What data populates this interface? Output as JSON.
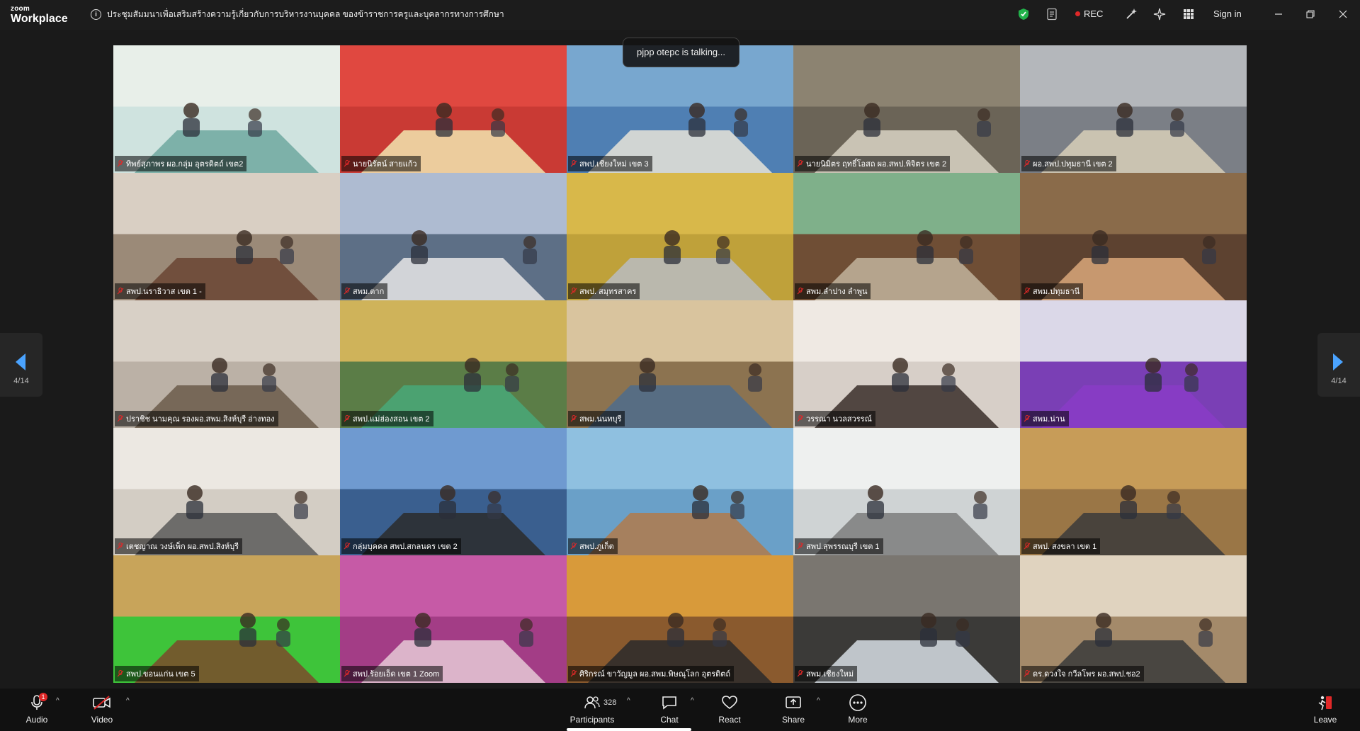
{
  "app": {
    "brand_small": "zoom",
    "brand_large": "Workplace"
  },
  "meeting": {
    "title": "ประชุมสัมมนาเพื่อเสริมสร้างความรู้เกี่ยวกับการบริหารงานบุคคล ของข้าราชการครูและบุคลากรทางการศึกษา",
    "recording_label": "REC",
    "sign_in_label": "Sign in",
    "talking_label": "pjpp otepc is talking..."
  },
  "pagination": {
    "left": "4/14",
    "right": "4/14"
  },
  "tiles": [
    {
      "name": "ทิพย์สุภาพร ผอ.กลุ่ม อุตรดิตถ์ เขต2",
      "bg": "#cfe3df",
      "wall": "#e8efe9",
      "accent": "#6fa8a0"
    },
    {
      "name": "นายนิรัตน์ สายแก้ว",
      "bg": "#c93a34",
      "wall": "#e04840",
      "accent": "#f2e6b0"
    },
    {
      "name": "สพป.เชียงใหม่ เขต 3",
      "bg": "#4f7fb3",
      "wall": "#78a7cf",
      "accent": "#e7e4d8"
    },
    {
      "name": "นายนิมิตร ฤทธิ์โอสถ ผอ.สพป.พิจิตร เขต 2",
      "bg": "#6b6457",
      "wall": "#8c8371",
      "accent": "#d9d3c4"
    },
    {
      "name": "ผอ.สพป.ปทุมธานี เขต 2",
      "bg": "#7b7f86",
      "wall": "#b4b7bb",
      "accent": "#d8cfb8"
    },
    {
      "name": "สพป.นราธิวาส เขต 1 -",
      "bg": "#9b8a78",
      "wall": "#d9cfc3",
      "accent": "#6a4432"
    },
    {
      "name": "สพม.ตาก",
      "bg": "#5d6f86",
      "wall": "#aebbd1",
      "accent": "#e6e6e6"
    },
    {
      "name": "สพป. สมุทรสาคร",
      "bg": "#bfa13a",
      "wall": "#d8b84a",
      "accent": "#b9bcc2"
    },
    {
      "name": "สพม.ลำปาง ลำพูน",
      "bg": "#6f4e35",
      "wall": "#7fb08a",
      "accent": "#c2b49c"
    },
    {
      "name": "สพม.ปทุมธานี",
      "bg": "#5d4230",
      "wall": "#8a6b4a",
      "accent": "#d9a77a"
    },
    {
      "name": "ปราชิช นามคุณ รองผอ.สพม.สิงห์บุรี อ่างทอง",
      "bg": "#bbb1a6",
      "wall": "#d8d0c6",
      "accent": "#6b5c4a"
    },
    {
      "name": "สพป.แม่ฮ่องสอน เขต 2",
      "bg": "#5b7d47",
      "wall": "#cfb35a",
      "accent": "#49a879"
    },
    {
      "name": "สพม.นนทบุรี",
      "bg": "#8c7350",
      "wall": "#d9c49e",
      "accent": "#4e6c8c"
    },
    {
      "name": "วรรณา นวลสวรรณ์",
      "bg": "#d7cfc8",
      "wall": "#efe9e3",
      "accent": "#3a2e29"
    },
    {
      "name": "สพม.น่าน",
      "bg": "#7a3fb5",
      "wall": "#dbd8e8",
      "accent": "#8a3cc7"
    },
    {
      "name": "เตชญาณ วงษ์เพ็ก ผอ.สพป.สิงห์บุรี",
      "bg": "#d3cdc4",
      "wall": "#ece8e2",
      "accent": "#5a5a5a"
    },
    {
      "name": "กลุ่มบุคคล สพป.สกลนคร เขต 2",
      "bg": "#3a5f8f",
      "wall": "#6f9ad0",
      "accent": "#2b2b2b"
    },
    {
      "name": "สพป.ภูเก็ต",
      "bg": "#6aa0c8",
      "wall": "#8fc0e0",
      "accent": "#b07a4b"
    },
    {
      "name": "สพป.สุพรรณบุรี เขต 1",
      "bg": "#cfd3d4",
      "wall": "#eef0ef",
      "accent": "#7d7d7d"
    },
    {
      "name": "สพป. สงขลา เขต 1",
      "bg": "#9a7646",
      "wall": "#c79c58",
      "accent": "#3b3b3b"
    },
    {
      "name": "สพป.ขอนแก่น เขต 5",
      "bg": "#3ec43a",
      "wall": "#c8a45a",
      "accent": "#7b4a2b"
    },
    {
      "name": "สพป.ร้อยเอ็ด เขต 1 Zoom",
      "bg": "#a33d86",
      "wall": "#c65aa6",
      "accent": "#e6c9d6"
    },
    {
      "name": "ศิริกรณ์ ขาวัญมูล ผอ.สพม.พิษณุโลก อุตรดิตถ์",
      "bg": "#8a5a2e",
      "wall": "#d89a3a",
      "accent": "#2a2a2a"
    },
    {
      "name": "สพม.เชียงใหม่",
      "bg": "#3b3a38",
      "wall": "#7a7670",
      "accent": "#d7dee4"
    },
    {
      "name": "ดร.ดวงใจ กวีลโพร ผอ.สพป.ชอ2",
      "bg": "#a48a6a",
      "wall": "#e0d3bf",
      "accent": "#3a3a3a"
    }
  ],
  "toolbar": {
    "audio_label": "Audio",
    "audio_badge": "1",
    "video_label": "Video",
    "participants_label": "Participants",
    "participants_count": "328",
    "chat_label": "Chat",
    "react_label": "React",
    "share_label": "Share",
    "more_label": "More",
    "leave_label": "Leave"
  },
  "colors": {
    "mic_muted": "#e02828",
    "rec_dot": "#e02828",
    "security_green": "#21b24a",
    "nav_arrow": "#4aa3ff"
  }
}
